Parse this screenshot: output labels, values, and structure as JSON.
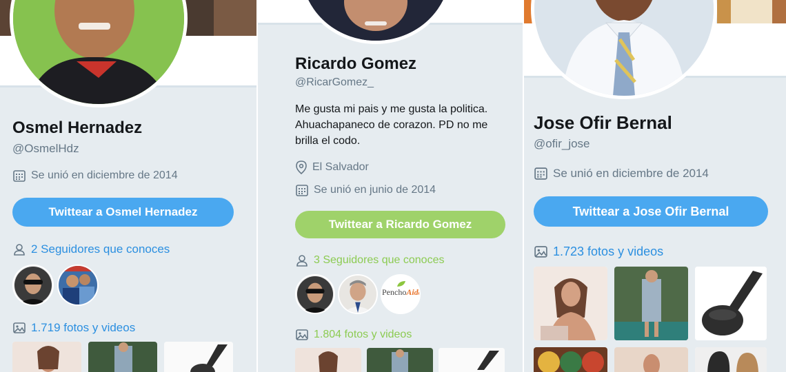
{
  "profiles": [
    {
      "name": "Osmel Hernadez",
      "handle": "@OsmelHdz",
      "joined": "Se unió en diciembre de 2014",
      "tweet_button": "Twittear a Osmel Hernadez",
      "followers_link": "2 Seguidores que conoces",
      "media_link": "1.719 fotos y videos",
      "accent": "#4aa8f0",
      "icons": [
        "calendar-icon",
        "person-icon",
        "image-icon"
      ]
    },
    {
      "name": "Ricardo Gomez",
      "handle": "@RicarGomez_",
      "bio": "Me gusta mi pais y me gusta la politica. Ahuachapaneco de corazon. PD no me brilla el codo.",
      "location": "El Salvador",
      "joined": "Se unió en junio de 2014",
      "tweet_button": "Twittear a Ricardo Gomez",
      "followers_link": "3 Seguidores que conoces",
      "media_link": "1.804 fotos y videos",
      "accent": "#9fd26a",
      "follower_logo": {
        "part1": "Pencho",
        "part2": "Aida"
      },
      "icons": [
        "location-pin-icon",
        "calendar-icon",
        "person-icon",
        "image-icon"
      ]
    },
    {
      "name": "Jose Ofir Bernal",
      "handle": "@ofir_jose",
      "joined": "Se unió en diciembre de 2014",
      "tweet_button": "Twittear a Jose Ofir Bernal",
      "media_link": "1.723 fotos y videos",
      "accent": "#4aa8f0",
      "icons": [
        "calendar-icon",
        "image-icon"
      ]
    }
  ]
}
